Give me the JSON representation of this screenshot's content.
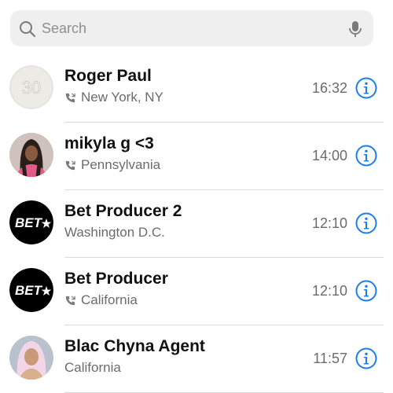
{
  "search": {
    "placeholder": "Search",
    "search_icon": "search-icon",
    "mic_icon": "microphone-icon"
  },
  "colors": {
    "accent": "#1a7ef0",
    "secondary_text": "#6b6b6b",
    "search_bg": "#efefef"
  },
  "calls": [
    {
      "name": "Roger Paul",
      "location": "New York, NY",
      "time": "16:32",
      "has_phone_icon": true,
      "avatar_text": "30"
    },
    {
      "name": "mikyla g <3",
      "location": "Pennsylvania",
      "time": "14:00",
      "has_phone_icon": true
    },
    {
      "name": "Bet Producer 2",
      "location": "Washington D.C.",
      "time": "12:10",
      "has_phone_icon": false,
      "avatar_text": "BET"
    },
    {
      "name": "Bet Producer",
      "location": "California",
      "time": "12:10",
      "has_phone_icon": true,
      "avatar_text": "BET"
    },
    {
      "name": "Blac Chyna Agent",
      "location": "California",
      "time": "11:57",
      "has_phone_icon": false
    }
  ]
}
